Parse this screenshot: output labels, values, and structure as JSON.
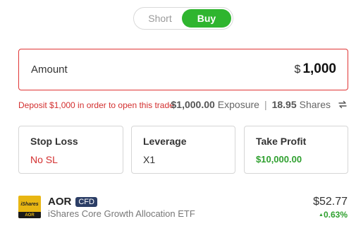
{
  "direction_toggle": {
    "short_label": "Short",
    "buy_label": "Buy",
    "selected": "Buy"
  },
  "amount": {
    "label": "Amount",
    "currency": "$",
    "value": "1,000"
  },
  "warning": "Deposit $1,000 in order to open this trade",
  "exposure": {
    "value": "$1,000.00",
    "label": "Exposure",
    "separator": "|",
    "shares_value": "18.95",
    "shares_label": "Shares"
  },
  "cards": {
    "stop_loss": {
      "title": "Stop Loss",
      "value": "No SL"
    },
    "leverage": {
      "title": "Leverage",
      "value": "X1"
    },
    "take_profit": {
      "title": "Take Profit",
      "value": "$10,000.00"
    }
  },
  "instrument": {
    "logo_top": "iShares",
    "logo_bottom": "AOR",
    "ticker": "AOR",
    "badge": "CFD",
    "name": "iShares Core Growth Allocation ETF",
    "price": "$52.77",
    "change": "0.63%",
    "change_arrow": "▲"
  },
  "colors": {
    "buy": "#2fb52f",
    "danger": "#d32f2f",
    "positive": "#2fa02f",
    "badge": "#2c3e66",
    "logo": "#e8b613"
  },
  "icons": {
    "swap": "swap-arrows-icon"
  }
}
